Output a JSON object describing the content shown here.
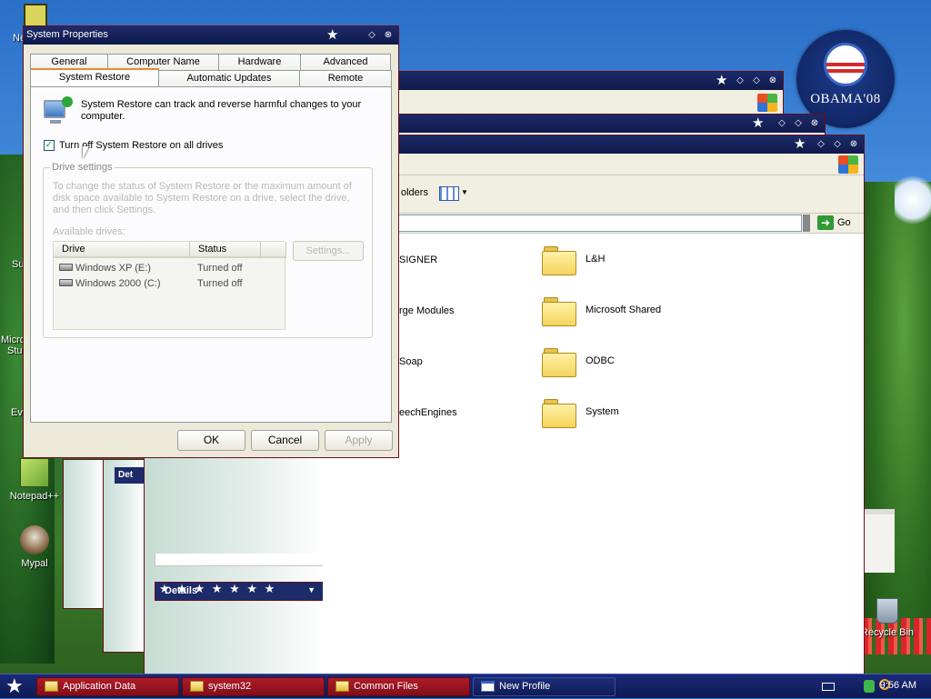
{
  "dialog": {
    "title": "System Properties",
    "tabs_row1": [
      "General",
      "Computer Name",
      "Hardware",
      "Advanced"
    ],
    "tabs_row2": [
      "System Restore",
      "Automatic Updates",
      "Remote"
    ],
    "active_tab": "System Restore",
    "description": "System Restore can track and reverse harmful changes to your computer.",
    "checkbox_label": "Turn off System Restore on all drives",
    "checkbox_checked": true,
    "group_label": "Drive settings",
    "group_desc": "To change the status of System Restore or the maximum amount of disk space available to System Restore on a drive, select the drive, and then click Settings.",
    "available_label": "Available drives:",
    "columns": [
      "Drive",
      "Status"
    ],
    "drives": [
      {
        "name": "Windows XP (E:)",
        "status": "Turned off"
      },
      {
        "name": "Windows 2000 (C:)",
        "status": "Turned off"
      }
    ],
    "settings_btn": "Settings...",
    "ok_btn": "OK",
    "cancel_btn": "Cancel",
    "apply_btn": "Apply"
  },
  "explorer": {
    "folders_btn": "olders",
    "go_label": "Go",
    "details_label": "Details",
    "items": [
      {
        "name": "SIGNER",
        "partial": true
      },
      {
        "name": "L&H",
        "partial": false
      },
      {
        "name": "rge Modules",
        "partial": true
      },
      {
        "name": "Microsoft Shared",
        "partial": false
      },
      {
        "name": "Soap",
        "partial": true
      },
      {
        "name": "ODBC",
        "partial": false
      },
      {
        "name": "eechEngines",
        "partial": true
      },
      {
        "name": "System",
        "partial": false
      }
    ]
  },
  "desktop": {
    "icons": [
      {
        "name": "Notepad++"
      },
      {
        "name": "Mypal"
      },
      {
        "name": "Recycle Bin"
      }
    ],
    "partial_labels": [
      "Ne",
      "Su",
      "Micro",
      "Stu",
      "Ev"
    ],
    "badge_text": "OBAMA'08"
  },
  "strips": {
    "details_label": "Det"
  },
  "taskbar": {
    "items": [
      {
        "label": "Application Data",
        "active": false
      },
      {
        "label": "system32",
        "active": false
      },
      {
        "label": "Common Files",
        "active": false
      },
      {
        "label": "New Profile",
        "active": true
      }
    ],
    "clock": "9:56 AM"
  },
  "colors": {
    "titlebar": "#1c2b6a",
    "window_border": "#6b0d1a",
    "taskbar_button": "#b01b28",
    "dialog_bg": "#ece9d8"
  }
}
